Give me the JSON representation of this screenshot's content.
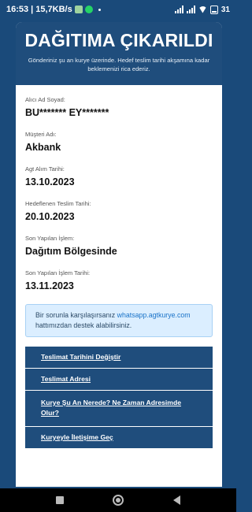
{
  "status_bar": {
    "time": "16:53",
    "speed": "15,7KB/s",
    "battery": "31"
  },
  "header": {
    "title": "DAĞITIMA ÇIKARILDI",
    "subtitle": "Gönderiniz şu an kurye üzerinde. Hedef teslim tarihi akşamına kadar beklemenizi rica ederiz."
  },
  "fields": [
    {
      "label": "Alıcı Ad Soyad:",
      "value": "BU******* EY*******"
    },
    {
      "label": "Müşteri Adı:",
      "value": "Akbank"
    },
    {
      "label": "Agt Alım Tarihi:",
      "value": "13.10.2023"
    },
    {
      "label": "Hedeflenen Teslim Tarihi:",
      "value": "20.10.2023"
    },
    {
      "label": "Son Yapılan İşlem:",
      "value": "Dağıtım Bölgesinde"
    },
    {
      "label": "Son Yapılan İşlem Tarihi:",
      "value": "13.11.2023"
    }
  ],
  "notice": {
    "text_before": "Bir sorunla karşılaşırsanız",
    "link": "whatsapp.agtkurye.com",
    "text_after": " hattımızdan destek alabilirsiniz."
  },
  "actions": [
    {
      "label": "Teslimat Tarihini Değiştir"
    },
    {
      "label": "Teslimat Adresi"
    },
    {
      "label": "Kurye Şu An Nerede? Ne Zaman Adresimde Olur?"
    },
    {
      "label": "Kuryeyle İletişime Geç"
    }
  ],
  "colors": {
    "primary": "#1f4d7c",
    "notice_bg": "#dbeeff",
    "link": "#1a73c8"
  }
}
